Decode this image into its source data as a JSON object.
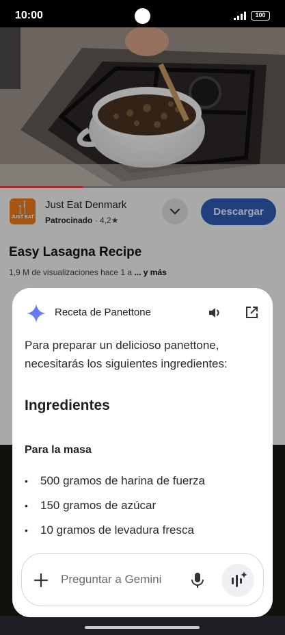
{
  "status": {
    "time": "10:00",
    "battery": "100"
  },
  "video": {
    "progress_percent": 29
  },
  "ad": {
    "advertiser": "Just Eat Denmark",
    "sponsored_label": "Patrocinado",
    "rating": "4,2★",
    "logo_text": "JUST EAT",
    "download_label": "Descargar"
  },
  "youtube": {
    "title": "Easy Lasagna Recipe",
    "views_meta": "1,9 M de visualizaciones  hace 1 a",
    "more_label": "... y más"
  },
  "gemini": {
    "title": "Receta de Panettone",
    "intro": "Para preparar un delicioso panettone, necesitarás los siguientes ingredientes:",
    "section_heading": "Ingredientes",
    "subsection_heading": "Para la masa",
    "ingredients": [
      "500 gramos de harina de fuerza",
      "150 gramos de azúcar",
      "10 gramos de levadura fresca"
    ],
    "input_placeholder": "Preguntar a Gemini"
  },
  "colors": {
    "accent_blue": "#2f5bb4",
    "gemini_blue": "#4285f4",
    "progress_red": "#e8404a",
    "brand_orange": "#f27a1a"
  },
  "icons": [
    "gemini-sparkle-icon",
    "speaker-icon",
    "open-external-icon",
    "plus-icon",
    "microphone-icon",
    "gemini-live-icon",
    "chevron-down-icon"
  ]
}
